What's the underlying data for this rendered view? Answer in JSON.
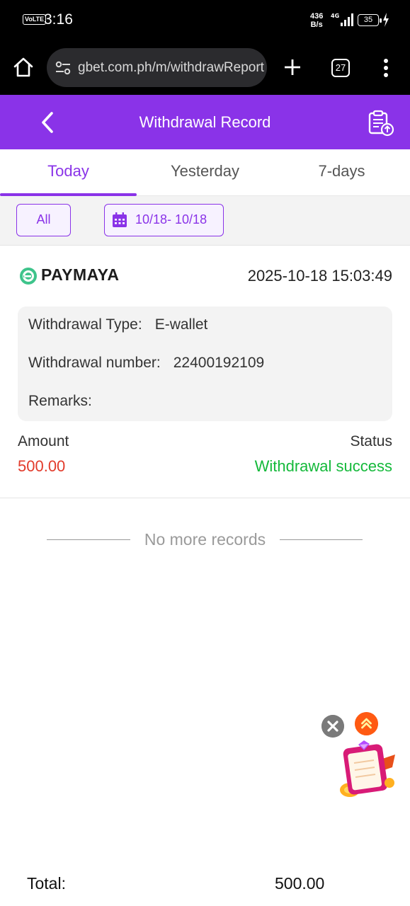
{
  "status_bar": {
    "volte": "VoLTE",
    "time": "3:16",
    "net_speed_value": "436",
    "net_speed_unit": "B/s",
    "network": "4G",
    "battery": "35"
  },
  "browser": {
    "url": "gbet.com.ph/m/withdrawReport",
    "tab_count": "27"
  },
  "header": {
    "title": "Withdrawal Record"
  },
  "tabs": [
    {
      "label": "Today",
      "active": true
    },
    {
      "label": "Yesterday",
      "active": false
    },
    {
      "label": "7-days",
      "active": false
    }
  ],
  "filters": {
    "all_label": "All",
    "date_range": "10/18- 10/18"
  },
  "record": {
    "provider": "PAYMAYA",
    "datetime": "2025-10-18 15:03:49",
    "withdrawal_type_label": "Withdrawal Type:",
    "withdrawal_type_value": "E-wallet",
    "withdrawal_number_label": "Withdrawal number:",
    "withdrawal_number_value": "22400192109",
    "remarks_label": "Remarks:",
    "remarks_value": "",
    "amount_label": "Amount",
    "amount_value": "500.00",
    "status_label": "Status",
    "status_value": "Withdrawal success"
  },
  "list_end_text": "No more records",
  "total": {
    "label": "Total:",
    "value": "500.00"
  },
  "colors": {
    "accent": "#8a33e8",
    "amount": "#e23b2b",
    "success": "#14b93a",
    "paymaya_green": "#3ec48b"
  }
}
